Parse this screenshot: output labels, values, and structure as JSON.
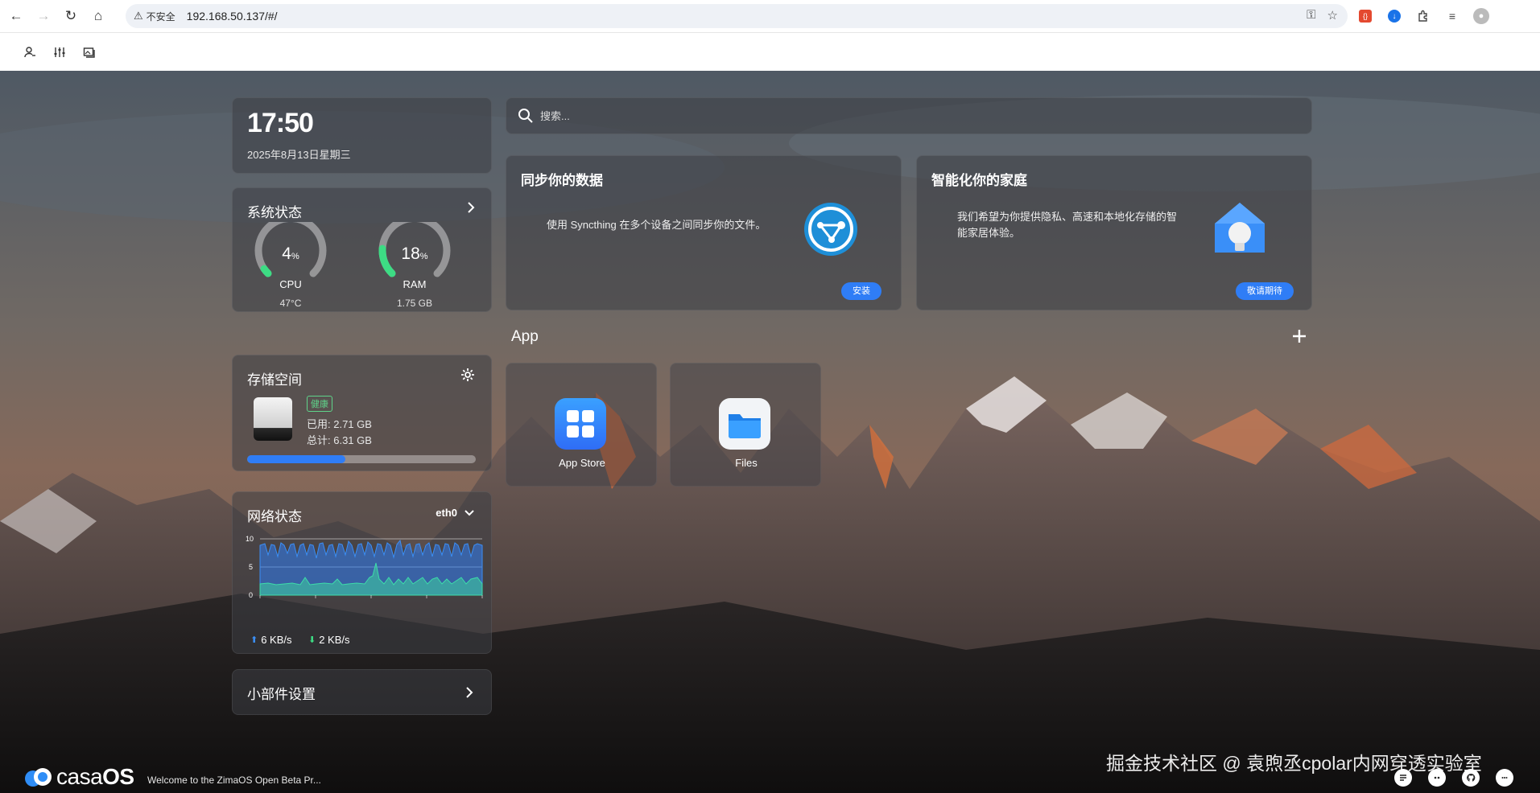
{
  "browser": {
    "insecure_label": "不安全",
    "url": "192.168.50.137/#/"
  },
  "clock": {
    "time": "17:50",
    "date": "2025年8月13日星期三"
  },
  "system_status": {
    "title": "系统状态",
    "cpu": {
      "value": "4",
      "unit": "%",
      "label": "CPU",
      "sub": "47°C",
      "percent": 4
    },
    "ram": {
      "value": "18",
      "unit": "%",
      "label": "RAM",
      "sub": "1.75 GB",
      "percent": 18
    }
  },
  "storage": {
    "title": "存储空间",
    "health": "健康",
    "used": "已用: 2.71 GB",
    "total": "总计: 6.31 GB",
    "used_fraction": 0.43
  },
  "network": {
    "title": "网络状态",
    "interface": "eth0",
    "y_ticks": [
      "10",
      "5",
      "0"
    ],
    "upload": "6 KB/s",
    "download": "2 KB/s"
  },
  "widget_settings": {
    "title": "小部件设置"
  },
  "search": {
    "placeholder": "搜索..."
  },
  "promo_sync": {
    "title": "同步你的数据",
    "desc": "使用 Syncthing 在多个设备之间同步你的文件。",
    "button": "安装"
  },
  "promo_home": {
    "title": "智能化你的家庭",
    "desc_line1": "我们希望为你提供隐私、高速和本地化存储的智",
    "desc_line2": "能家居体验。",
    "button": "敬请期待"
  },
  "apps": {
    "title": "App",
    "items": [
      {
        "label": "App Store"
      },
      {
        "label": "Files"
      }
    ]
  },
  "footer": {
    "logo_text": "casaOS",
    "logo_light": "casa",
    "logo_bold": "OS",
    "welcome": "Welcome to the ZimaOS Open Beta Pr...",
    "watermark": "掘金技术社区 @ 袁煦丞cpolar内网穿透实验室"
  },
  "colors": {
    "accent": "#2f7df6",
    "gauge_green": "#3ddc84",
    "health": "#5fd38a"
  }
}
